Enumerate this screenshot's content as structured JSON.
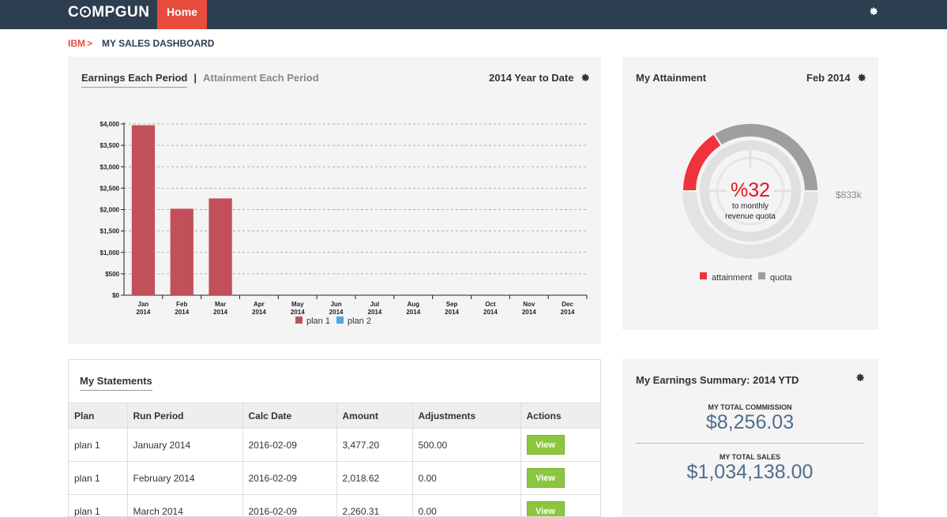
{
  "header": {
    "logo": "COMPGUN",
    "nav": {
      "home": "Home"
    }
  },
  "breadcrumb": {
    "root": "IBM",
    "separator": ">",
    "current": "MY SALES DASHBOARD"
  },
  "earnings_panel": {
    "tab_active": "Earnings Each Period",
    "tab_divider": "|",
    "tab_inactive": "Attainment Each Period",
    "period": "2014 Year to Date"
  },
  "chart_data": [
    {
      "type": "bar",
      "categories": [
        "Jan 2014",
        "Feb 2014",
        "Mar 2014",
        "Apr 2014",
        "May 2014",
        "Jun 2014",
        "Jul 2014",
        "Aug 2014",
        "Sep 2014",
        "Oct 2014",
        "Nov 2014",
        "Dec 2014"
      ],
      "tick_top": [
        "Jan",
        "Feb",
        "Mar",
        "Apr",
        "May",
        "Jun",
        "Jul",
        "Aug",
        "Sep",
        "Oct",
        "Nov",
        "Dec"
      ],
      "tick_bottom": [
        "2014",
        "2014",
        "2014",
        "2014",
        "2014",
        "2014",
        "2014",
        "2014",
        "2014",
        "2014",
        "2014",
        "2014"
      ],
      "series": [
        {
          "name": "plan 1",
          "color": "#c1505a",
          "values": [
            3970,
            2020,
            2260,
            0,
            0,
            0,
            0,
            0,
            0,
            0,
            0,
            0
          ]
        },
        {
          "name": "plan 2",
          "color": "#4aa8e8",
          "values": [
            0,
            0,
            0,
            0,
            0,
            0,
            0,
            0,
            0,
            0,
            0,
            0
          ]
        }
      ],
      "ylim": [
        0,
        4000
      ],
      "yticks": [
        0,
        500,
        1000,
        1500,
        2000,
        2500,
        3000,
        3500,
        4000
      ],
      "ytick_labels": [
        "$0",
        "$500",
        "$1,000",
        "$1,500",
        "$2,000",
        "$2,500",
        "$3,000",
        "$3,500",
        "$4,000"
      ],
      "grid": true,
      "legend": "bottom"
    },
    {
      "type": "pie",
      "subtype": "donut",
      "slices": [
        {
          "name": "attainment",
          "value": 32,
          "color": "#f0323c"
        },
        {
          "name": "quota",
          "value": 68,
          "color": "#9e9e9e"
        }
      ],
      "center_value": "%32",
      "center_caption_1": "to monthly",
      "center_caption_2": "revenue quota",
      "side_label": "$833k",
      "legend": "bottom"
    }
  ],
  "attainment_panel": {
    "title": "My Attainment",
    "period": "Feb 2014"
  },
  "statements": {
    "title": "My Statements",
    "columns": [
      "Plan",
      "Run Period",
      "Calc Date",
      "Amount",
      "Adjustments",
      "Actions"
    ],
    "rows": [
      [
        "plan 1",
        "January 2014",
        "2016-02-09",
        "3,477.20",
        "500.00",
        "View"
      ],
      [
        "plan 1",
        "February 2014",
        "2016-02-09",
        "2,018.62",
        "0.00",
        "View"
      ],
      [
        "plan 1",
        "March 2014",
        "2016-02-09",
        "2,260.31",
        "0.00",
        "View"
      ]
    ]
  },
  "summary": {
    "title": "My Earnings Summary: 2014 YTD",
    "commission_label": "MY TOTAL COMMISSION",
    "commission_value": "$8,256.03",
    "sales_label": "MY TOTAL SALES",
    "sales_value": "$1,034,138.00"
  },
  "colors": {
    "topbar": "#2c3e50",
    "accent": "#e74c3c",
    "button": "#8cc63f",
    "summary_value": "#4f6e8f"
  },
  "icons": {
    "settings": "gear-icon"
  }
}
